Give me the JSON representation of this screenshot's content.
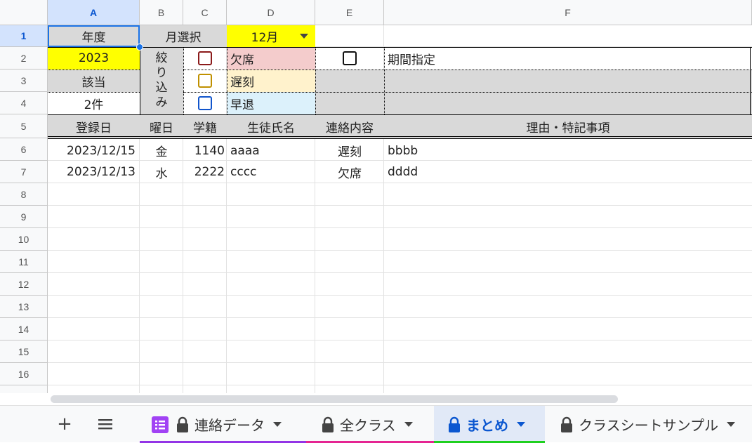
{
  "columns": [
    "A",
    "B",
    "C",
    "D",
    "E",
    "F"
  ],
  "rows": [
    "1",
    "2",
    "3",
    "4",
    "5",
    "6",
    "7",
    "8",
    "9",
    "10",
    "11",
    "12",
    "13",
    "14",
    "15",
    "16"
  ],
  "filter": {
    "year_label": "年度",
    "year_value": "2023",
    "match_label": "該当",
    "match_count": "2件",
    "month_label": "月選択",
    "month_value": "12月",
    "narrow_label_chars": [
      "絞",
      "り",
      "込",
      "み"
    ],
    "options": [
      {
        "label": "欠席",
        "color": "#8b1a1a",
        "fill": "#f4cccc"
      },
      {
        "label": "遅刻",
        "color": "#bf9000",
        "fill": "#fff2cc"
      },
      {
        "label": "早退",
        "color": "#1155cc",
        "fill": "#dcf1fb"
      }
    ],
    "period_label": "期間指定"
  },
  "table": {
    "headers": [
      "登録日",
      "曜日",
      "学籍",
      "生徒氏名",
      "連絡内容",
      "理由・特記事項"
    ],
    "rows": [
      [
        "2023/12/15",
        "金",
        "1140",
        "aaaa",
        "遅刻",
        "bbbb"
      ],
      [
        "2023/12/13",
        "水",
        "2222",
        "cccc",
        "欠席",
        "dddd"
      ]
    ]
  },
  "tabs": [
    {
      "label": "連絡データ",
      "underline": "#9334e6",
      "active": false
    },
    {
      "label": "全クラス",
      "underline": "#e52592",
      "active": false
    },
    {
      "label": "まとめ",
      "underline": "#1fd01f",
      "active": true
    },
    {
      "label": "クラスシートサンプル",
      "underline": "",
      "active": false
    }
  ],
  "colors": {
    "yellow": "#ffff00",
    "gray": "#d9d9d9",
    "selection": "#1a73e8",
    "active_tab": "#0b57d0"
  }
}
